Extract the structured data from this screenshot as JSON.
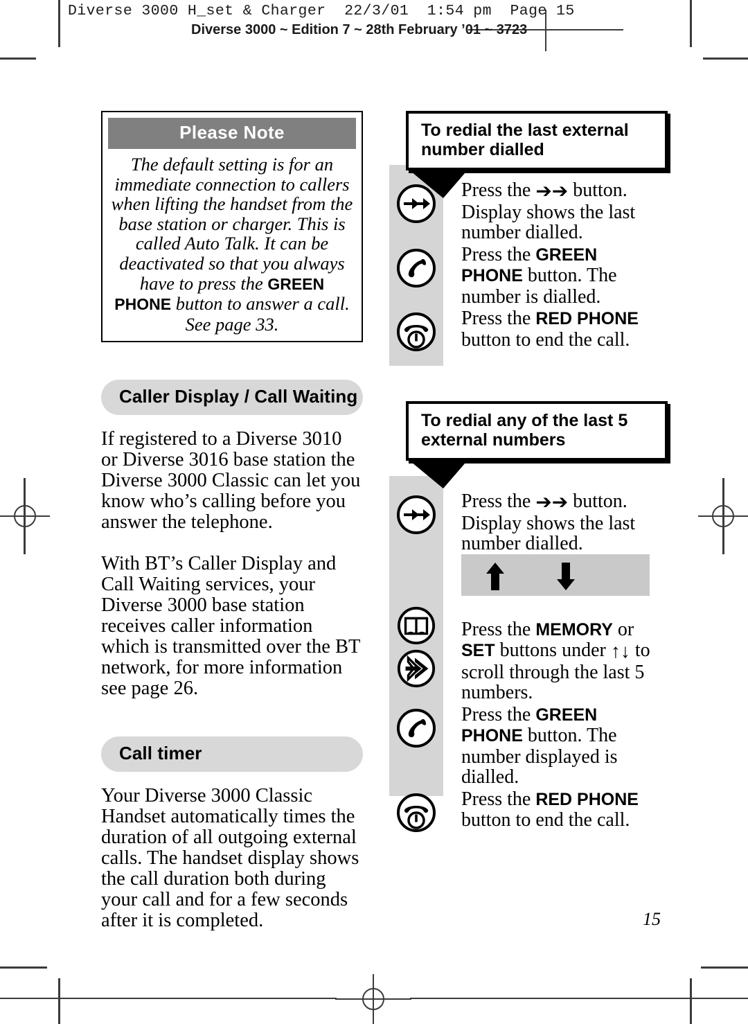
{
  "header": {
    "slug_line1": "Diverse 3000 H_set & Charger  22/3/01  1:54 pm  Page 15",
    "slug_line2": "Diverse 3000 ~ Edition 7 ~ 28th February ’01 ~ 3723"
  },
  "page_number": "15",
  "colors": {
    "note_header_bg": "#808080",
    "pill_bg": "#d8d8d8",
    "icon_rail_bg": "#d5d5d5",
    "arrow_bar_bg": "#c9c9c9",
    "text": "#000000",
    "crop_mark": "#3b3b3b"
  },
  "left_column": {
    "note_box": {
      "title": "Please Note",
      "body_pre": "The default setting is for an immediate connection to callers when lifting the handset from the base station or charger. This is called Auto Talk. It can be deactivated so that you always have to press the ",
      "body_bold": "GREEN PHONE",
      "body_post": " button to answer a call. See page 33."
    },
    "sections": [
      {
        "heading": "Caller Display / Call Waiting",
        "paragraphs": [
          "If registered to a Diverse 3010 or Diverse 3016 base station the Diverse 3000 Classic can let you know who’s calling before you answer the telephone.",
          "With BT’s Caller Display and Call Waiting services, your Diverse 3000 base station receives caller information which is transmitted over the BT network, for more information see page 26."
        ]
      },
      {
        "heading": "Call timer",
        "paragraphs": [
          "Your Diverse 3000 Classic Handset automatically times the duration of all outgoing external calls. The handset display shows the call duration both during your call and for a few seconds after it is completed."
        ]
      }
    ]
  },
  "right_column": {
    "blocks": [
      {
        "callout_title": "To redial the last external number dialled",
        "steps": [
          {
            "icon": "redial-button-icon",
            "text_pre": "Press the ",
            "text_glyph": "➔➔",
            "text_bold": "",
            "text_post": " button. Display shows the last number dialled."
          },
          {
            "icon": "green-phone-icon",
            "text_pre": "Press the ",
            "text_glyph": "",
            "text_bold": "GREEN PHONE",
            "text_post": " button. The number is dialled."
          },
          {
            "icon": "red-phone-icon",
            "text_pre": "Press the ",
            "text_glyph": "",
            "text_bold": "RED PHONE",
            "text_post": " button to end the call."
          }
        ]
      },
      {
        "callout_title": "To redial any of the last 5 external numbers",
        "steps_top": [
          {
            "icon": "redial-button-icon",
            "text_pre": "Press the ",
            "text_glyph": "➔➔",
            "text_bold": "",
            "text_post": " button. Display shows the last number dialled."
          }
        ],
        "arrow_bar": {
          "up_arrow": "up-arrow-icon",
          "down_arrow": "down-arrow-icon"
        },
        "steps_bottom": [
          {
            "icons": [
              "memory-book-icon",
              "set-arrow-icon"
            ],
            "text_pre": "Press the ",
            "text_bold1": "MEMORY",
            "text_mid1": " or ",
            "text_bold2": "SET",
            "text_mid2": " buttons under ",
            "text_glyph": "↑↓",
            "text_post": " to scroll through the last 5 numbers."
          },
          {
            "icon": "green-phone-icon",
            "text_pre": "Press the ",
            "text_bold": "GREEN PHONE",
            "text_post": " button. The number displayed is dialled."
          },
          {
            "icon": "red-phone-icon",
            "text_pre": "Press the ",
            "text_bold": "RED PHONE",
            "text_post": " button to end the call."
          }
        ]
      }
    ]
  }
}
